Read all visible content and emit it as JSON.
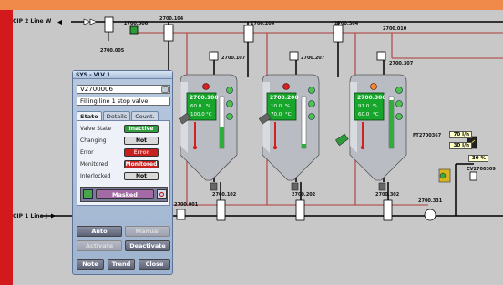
{
  "pipes": {
    "cip2": "CIP 2 Line W",
    "cip1": "CIP 1 Line J"
  },
  "tags": {
    "t2700005": "2700.005",
    "t2700006": "2700.006",
    "t2700104": "2700.104",
    "t2700204": "2700.204",
    "t2700304": "2700.304",
    "t2700010": "2700.010",
    "t2700107": "2700.107",
    "t2700207": "2700.207",
    "t2700307": "2700.307",
    "t2700102": "2700.102",
    "t2700202": "2700.202",
    "t2700302": "2700.302",
    "t2700001": "2700.001",
    "t2700331": "2700.331",
    "ft": "FT2700367",
    "cv": "CV2700309"
  },
  "tanks": [
    {
      "id": "2700.100",
      "line1": "60.0",
      "unit1": "%",
      "line2": "100.0",
      "unit2": "°C"
    },
    {
      "id": "2700.200",
      "line1": "10.0",
      "unit1": "%",
      "line2": "70.0",
      "unit2": "°C"
    },
    {
      "id": "2700.300",
      "line1": "91.0",
      "unit1": "%",
      "line2": "60.0",
      "unit2": "°C"
    }
  ],
  "flow": {
    "value1": "70 l/h",
    "value2": "30 l/h",
    "percent": "30 %"
  },
  "faceplate": {
    "title": "SYS - VLV 1",
    "tag": "V2700006",
    "description": "Filling line 1 stop valve",
    "tabs": [
      "State",
      "Details",
      "Count."
    ],
    "rows": [
      {
        "label": "Valve State",
        "value": "Inactive",
        "color": "#2f9e3c",
        "text": "#ffffff"
      },
      {
        "label": "Changing",
        "value": "Not",
        "color": "#d9d9d9",
        "text": "#000000"
      },
      {
        "label": "Error",
        "value": "Error",
        "color": "#c81f1f",
        "text": "#ffb0b0"
      },
      {
        "label": "Monitored",
        "value": "Monitored",
        "color": "#c81f1f",
        "text": "#ffffff"
      },
      {
        "label": "Interlocked",
        "value": "Not",
        "color": "#d9d9d9",
        "text": "#000000"
      }
    ],
    "mask_label": "Masked",
    "buttons": {
      "auto": "Auto",
      "manual": "Manual",
      "activate": "Activate",
      "deactivate": "Deactivate",
      "note": "Note",
      "trend": "Trend",
      "close": "Close"
    }
  },
  "colors": {
    "top_bar": "#f08a4b",
    "left_strip": "#d4191c",
    "pipe_red": "#b03a3a",
    "screen_green": "#17a52b"
  }
}
